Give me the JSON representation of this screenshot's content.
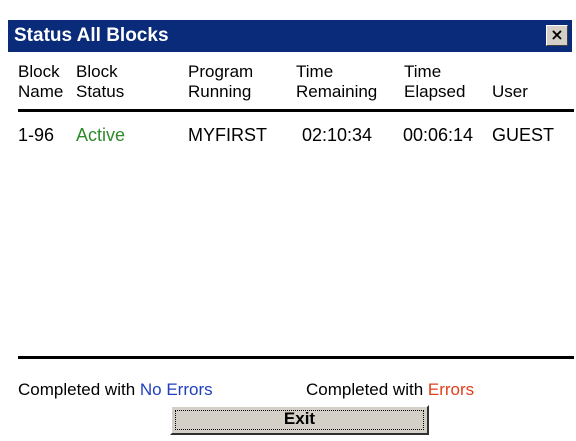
{
  "window": {
    "title": "Status All Blocks",
    "close_glyph": "×"
  },
  "table": {
    "columns": [
      {
        "line1": "Block",
        "line2": "Name"
      },
      {
        "line1": "Block",
        "line2": "Status"
      },
      {
        "line1": "Program",
        "line2": "Running"
      },
      {
        "line1": "Time",
        "line2": "Remaining"
      },
      {
        "line1": "Time",
        "line2": "Elapsed"
      },
      {
        "line1": "",
        "line2": "User"
      }
    ],
    "rows": [
      {
        "block_name": "1-96",
        "block_status": "Active",
        "program_running": "MYFIRST",
        "time_remaining": "02:10:34",
        "time_elapsed": "00:06:14",
        "user": "GUEST"
      }
    ]
  },
  "legend": {
    "ok_prefix": "Completed with ",
    "ok_highlight": "No Errors",
    "err_prefix": "Completed with ",
    "err_highlight": "Errors"
  },
  "buttons": {
    "exit_label": "Exit"
  },
  "colors": {
    "titlebar": "#0a2a7a",
    "active_status": "#2e8b2e",
    "no_errors": "#1f3fbf",
    "errors": "#e0401a"
  }
}
